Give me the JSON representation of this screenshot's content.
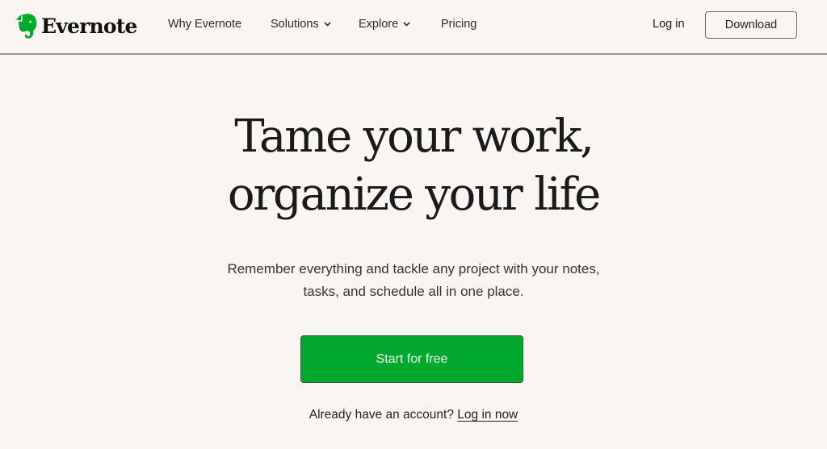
{
  "brand": {
    "name": "Evernote",
    "logo_icon": "evernote-elephant-icon",
    "accent_color": "#00a82d"
  },
  "nav": {
    "items": [
      {
        "label": "Why Evernote",
        "has_dropdown": false
      },
      {
        "label": "Solutions",
        "has_dropdown": true,
        "icon": "chevron-down-icon"
      },
      {
        "label": "Explore",
        "has_dropdown": true,
        "icon": "chevron-down-icon"
      },
      {
        "label": "Pricing",
        "has_dropdown": false
      }
    ],
    "login_label": "Log in",
    "download_label": "Download"
  },
  "hero": {
    "title_line1": "Tame your work,",
    "title_line2": "organize your life",
    "subtitle_line1": "Remember everything and tackle any project with your notes,",
    "subtitle_line2": "tasks, and schedule all in one place.",
    "cta_label": "Start for free",
    "account_prompt": "Already have an account?",
    "account_link": "Log in now"
  }
}
